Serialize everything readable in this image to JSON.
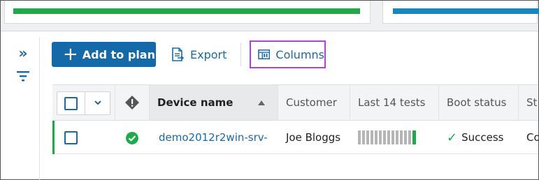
{
  "toolbar": {
    "add_label": "Add to plan",
    "export_label": "Export",
    "columns_label": "Columns"
  },
  "table": {
    "headers": [
      "Device name",
      "Customer",
      "Last 14 tests",
      "Boot status",
      "St"
    ],
    "rows": [
      {
        "device_name": "demo2012r2win-srv-",
        "customer": "Joe Bloggs",
        "last_tests_total": 14,
        "last_tests_recent_passed": 1,
        "boot_status": "Success",
        "next_col": "Co"
      }
    ]
  },
  "colors": {
    "accent_blue": "#1469a8",
    "link_blue": "#1a6aa6",
    "success_green": "#1fa94a",
    "highlight_purple": "#b83ee0",
    "card_bar_blue": "#1a86c0"
  },
  "icons": [
    "expand-icon",
    "filter-icon",
    "plus-icon",
    "export-icon",
    "columns-icon",
    "chevron-down-icon",
    "warning-icon",
    "success-icon",
    "check-icon",
    "sort-asc-icon"
  ]
}
